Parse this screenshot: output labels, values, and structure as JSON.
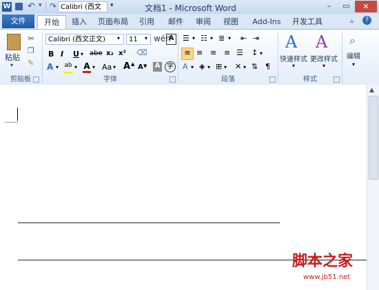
{
  "qat": {
    "font_box": "Calibri (西文",
    "app_icon": "W"
  },
  "titlebar": {
    "title": "文档1 - Microsoft Word"
  },
  "window_controls": {
    "minimize": "–",
    "maximize": "▭",
    "close": "✕"
  },
  "tabs": [
    {
      "label": "文件"
    },
    {
      "label": "开始"
    },
    {
      "label": "插入"
    },
    {
      "label": "页面布局"
    },
    {
      "label": "引用"
    },
    {
      "label": "邮件"
    },
    {
      "label": "审阅"
    },
    {
      "label": "视图"
    },
    {
      "label": "Add-Ins"
    },
    {
      "label": "开发工具"
    }
  ],
  "clipboard": {
    "paste": "粘贴",
    "label": "剪贴板"
  },
  "font": {
    "name": "Calibri (西文正文)",
    "size": "11",
    "label": "字体",
    "bold": "B",
    "italic": "I",
    "underline": "U",
    "strike": "abe",
    "sub": "x₂",
    "sup": "x²",
    "grow": "A",
    "shrink": "A",
    "changecase": "Aa",
    "clear": "A",
    "phonetic": "wén",
    "border": "A",
    "enclose": "字"
  },
  "paragraph": {
    "label": "段落"
  },
  "styles": {
    "quick": "快速样式",
    "change": "更改样式",
    "label": "样式"
  },
  "editing": {
    "label": "编辑"
  },
  "watermark": {
    "main": "脚本之家",
    "url": "www.jb51.net"
  },
  "colors": {
    "accent": "#2b579a",
    "file_tab": "#2f6bb8"
  }
}
